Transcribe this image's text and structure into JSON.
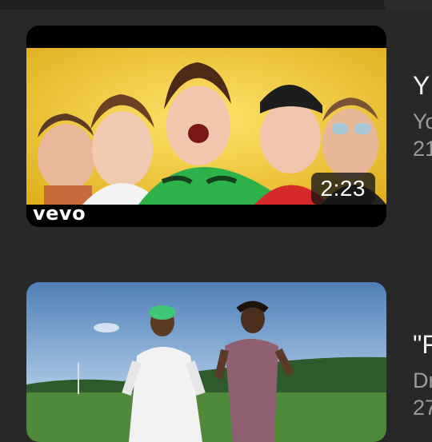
{
  "feed": {
    "videos": [
      {
        "duration": "2:23",
        "watermark": "vevo",
        "title": "Y",
        "channel": "Yo",
        "stats": "21"
      },
      {
        "duration": "",
        "watermark": "",
        "title": "\"F",
        "channel": "Dr",
        "stats": "27"
      }
    ]
  },
  "colors": {
    "background": "#282828",
    "title_text": "#f1f1f1",
    "secondary_text": "#9a9a9a",
    "thumb1_bg": "#f0cf3a",
    "hoodie_green": "#2fb14a"
  }
}
